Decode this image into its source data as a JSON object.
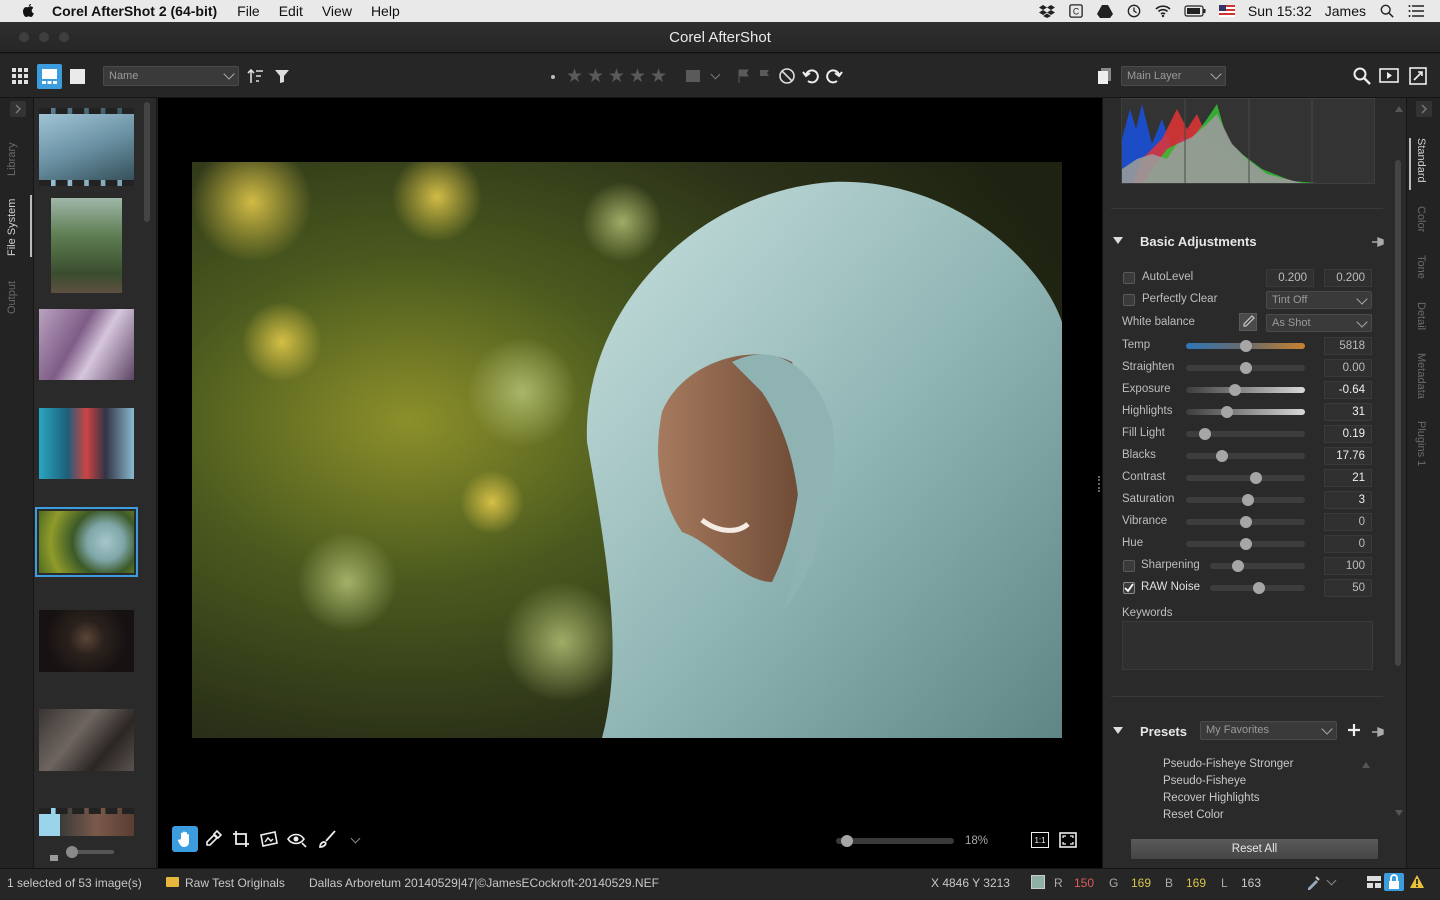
{
  "menubar": {
    "app_name": "Corel AfterShot 2 (64-bit)",
    "items": [
      "File",
      "Edit",
      "View",
      "Help"
    ],
    "clock": "Sun 15:32",
    "user": "James"
  },
  "window": {
    "title": "Corel AfterShot"
  },
  "toolbar": {
    "sort_select": "Name",
    "layer_select": "Main Layer"
  },
  "left_tabs": [
    "Library",
    "File System",
    "Output"
  ],
  "right_tabs": [
    "Standard",
    "Color",
    "Tone",
    "Detail",
    "Metadata",
    "Plugins 1"
  ],
  "basic": {
    "title": "Basic Adjustments",
    "autolevel_label": "AutoLevel",
    "autolevel_low": "0.200",
    "autolevel_high": "0.200",
    "perfectly_clear_label": "Perfectly Clear",
    "perfectly_clear_select": "Tint Off",
    "white_balance_label": "White balance",
    "white_balance_select": "As Shot",
    "sliders": [
      {
        "label": "Temp",
        "value": "5818",
        "pos": 0.5
      },
      {
        "label": "Straighten",
        "value": "0.00",
        "pos": 0.5
      },
      {
        "label": "Exposure",
        "value": "-0.64",
        "pos": 0.4
      },
      {
        "label": "Highlights",
        "value": "31",
        "pos": 0.33
      },
      {
        "label": "Fill Light",
        "value": "0.19",
        "pos": 0.12
      },
      {
        "label": "Blacks",
        "value": "17.76",
        "pos": 0.28
      },
      {
        "label": "Contrast",
        "value": "21",
        "pos": 0.6
      },
      {
        "label": "Saturation",
        "value": "3",
        "pos": 0.52
      },
      {
        "label": "Vibrance",
        "value": "0",
        "pos": 0.5
      },
      {
        "label": "Hue",
        "value": "0",
        "pos": 0.5
      }
    ],
    "sharpening_label": "Sharpening",
    "sharpening_value": "100",
    "rawnoise_label": "RAW Noise",
    "rawnoise_value": "50",
    "keywords_label": "Keywords"
  },
  "presets": {
    "title": "Presets",
    "select": "My Favorites",
    "items": [
      "Pseudo-Fisheye Stronger",
      "Pseudo-Fisheye",
      "Recover Highlights",
      "Reset Color"
    ],
    "reset_all": "Reset All"
  },
  "canvas": {
    "zoom": "18%",
    "zoom_pos": 0.05,
    "one_to_one": "1:1"
  },
  "status": {
    "selection": "1 selected of 53 image(s)",
    "folder": "Raw Test Originals",
    "filename": "Dallas Arboretum 20140529|47|©JamesECockroft-20140529.NEF",
    "coords": "X 4846  Y 3213",
    "r_label": "R",
    "r_value": "150",
    "g_label": "G",
    "g_value": "169",
    "b_label": "B",
    "b_value": "169",
    "l_label": "L",
    "l_value": "163"
  },
  "colors": {
    "accent": "#3b9ddd",
    "r": "#e05a5a",
    "g": "#d8c44a"
  }
}
